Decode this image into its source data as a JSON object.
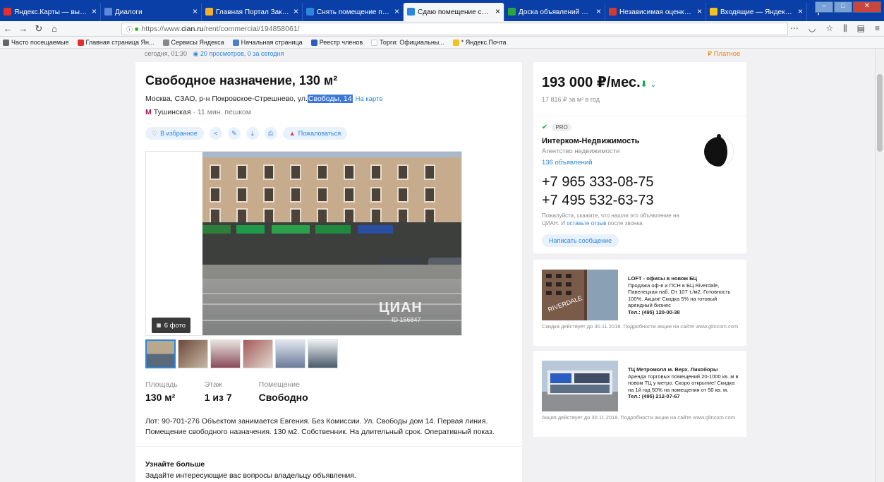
{
  "browser": {
    "tabs": [
      {
        "label": "Яндекс.Карты — выбирайте",
        "color": "#e62e2e"
      },
      {
        "label": "Диалоги",
        "color": "#5b88d8"
      },
      {
        "label": "Главная Портал Закупок",
        "color": "#f2b02a"
      },
      {
        "label": "Снять помещение под обще",
        "color": "#2b87db"
      },
      {
        "label": "Сдаю помещение свободно",
        "color": "#2b87db"
      },
      {
        "label": "Доска объявлений от частн",
        "color": "#29a83a"
      },
      {
        "label": "Независимая оценка недви",
        "color": "#d33b2c"
      },
      {
        "label": "Входящие — Яндекс.Почта",
        "color": "#f2c21a"
      }
    ],
    "active_tab": 4,
    "url_prefix": "https://www.",
    "url_domain": "cian.ru",
    "url_path": "/rent/commercial/194858061/",
    "bookmarks": [
      {
        "label": "Часто посещаемые",
        "color": "#666666"
      },
      {
        "label": "Главная страница Ян...",
        "color": "#e62e2e"
      },
      {
        "label": "Сервисы Яндекса",
        "color": "#888888"
      },
      {
        "label": "Начальная страница",
        "color": "#4a7fd1"
      },
      {
        "label": "Реестр членов",
        "color": "#2b5cc0"
      },
      {
        "label": "Торги: Официальны...",
        "color": "#ffffff"
      },
      {
        "label": "* Яндекс.Почта",
        "color": "#f2c21a"
      }
    ]
  },
  "listing": {
    "posted": "сегодня, 01:30",
    "views": "20 просмотров, 0 за сегодня",
    "paid_label": "Платное",
    "title": "Свободное назначение, 130 м²",
    "address_prefix": "Москва, СЗАО, р-н Покровское-Стрешнево, ул.",
    "address_street": "Свободы, 14",
    "map_link": "На карте",
    "metro": "Тушинская",
    "walk": "· 11 мин. пешком",
    "favorite_label": "В избранное",
    "complain_label": "Пожаловаться",
    "photo_count": "6 фото",
    "watermark": "ЦИАН",
    "watermark_id": "ID 156847",
    "stats": [
      {
        "label": "Площадь",
        "value": "130 м²"
      },
      {
        "label": "Этаж",
        "value": "1 из 7"
      },
      {
        "label": "Помещение",
        "value": "Свободно"
      }
    ],
    "description": "Лот: 90-701-276 Объектом занимается Евгения. Без Комиссии. Ул. Свободы дом 14. Первая линия. Помещение свободного назначения. 130 м2. Собственник. На длительный срок. Оперативный показ.",
    "learn_title": "Узнайте больше",
    "learn_sub": "Задайте интересующие вас вопросы владельцу объявления."
  },
  "price": {
    "amount": "193 000 ₽/мес.",
    "per_year": "17 816 ₽ за м² в год"
  },
  "agent": {
    "pro": "PRO",
    "name": "Интерком-Недвижимость",
    "type": "Агентство недвижимости",
    "count": "136 объявлений",
    "phone1": "+7 965 333-08-75",
    "phone2": "+7 495 532-63-73",
    "note_before": "Пожалуйста, скажите, что нашли это объявление на ЦИАН. И",
    "note_link": "оставьте отзыв",
    "note_after": "после звонка",
    "message_btn": "Написать сообщение"
  },
  "ads": [
    {
      "title": "LOFT - офисы в новом БЦ",
      "body": "Продажа оф-в и ПСН в БЦ Riverdale, Павелецкая наб. От 107 т./м2. Готовность 100%. Акция! Скидка 5% на готовый арендный бизнес",
      "tel": "Тел.: (495) 120-00-38",
      "foot": "Скидка действует до 30.11.2018. Подробности акции на сайте www.glincom.com",
      "sign": "RIVERDALE"
    },
    {
      "title": "ТЦ Метромолл м. Верх. Лихоборы",
      "body": "Аренда торговых помещений 20-1000 кв. м в новом ТЦ у метро. Скоро открытие! Скидка на 1й год 50% на помещения от 50 кв. м.",
      "tel": "Тел.: (495) 212-07-67",
      "foot": "Акция действует до 30.11.2018. Подробности акции на сайте www.glincom.com"
    }
  ]
}
